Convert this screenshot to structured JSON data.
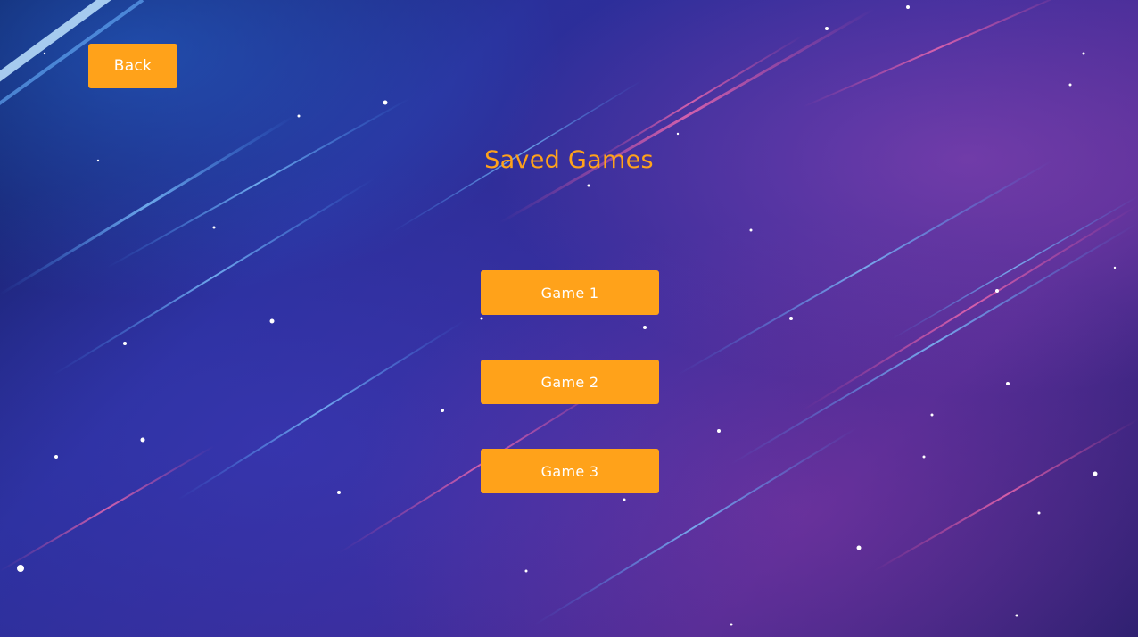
{
  "back_label": "Back",
  "title": "Saved Games",
  "games": [
    {
      "label": "Game 1"
    },
    {
      "label": "Game 2"
    },
    {
      "label": "Game 3"
    }
  ],
  "colors": {
    "accent": "#ffa21a",
    "button_text": "#ffffff"
  }
}
